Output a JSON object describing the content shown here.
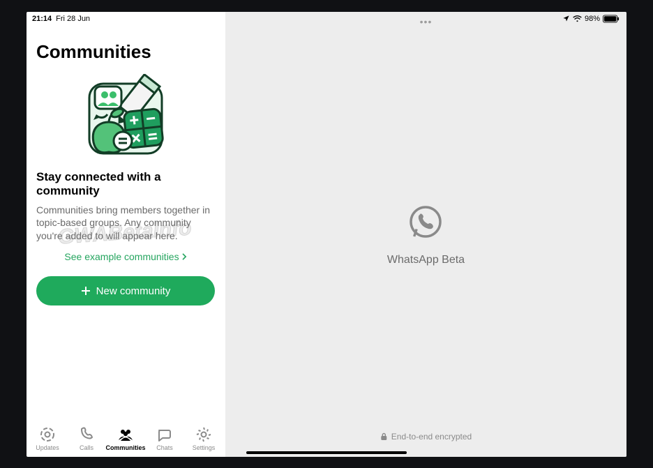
{
  "statusbar": {
    "time": "21:14",
    "date": "Fri 28 Jun",
    "battery_pct": "98%"
  },
  "left": {
    "title": "Communities",
    "subtitle": "Stay connected with a community",
    "description": "Communities bring members together in topic-based groups. Any community you're added to will appear here.",
    "example_link": "See example communities",
    "new_button": "New community"
  },
  "tabs": {
    "updates": "Updates",
    "calls": "Calls",
    "communities": "Communities",
    "chats": "Chats",
    "settings": "Settings",
    "active": "communities"
  },
  "right": {
    "app_name": "WhatsApp Beta",
    "encrypted": "End-to-end encrypted"
  },
  "watermark": "GWABetaInfo"
}
